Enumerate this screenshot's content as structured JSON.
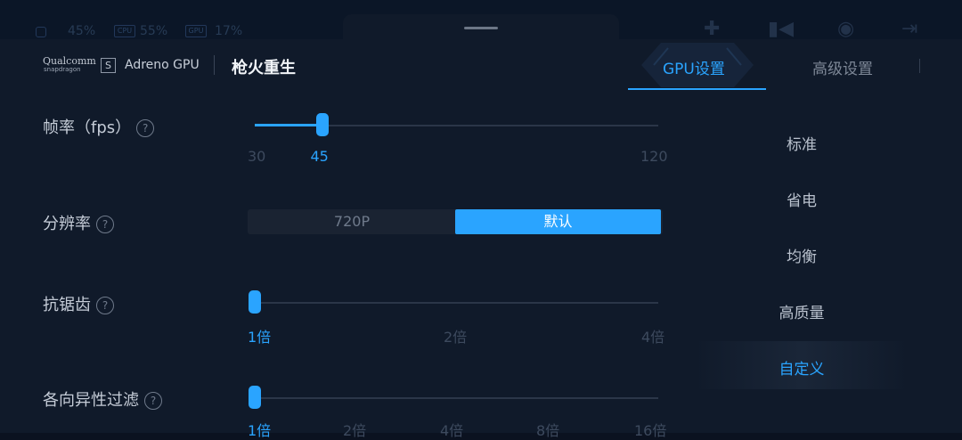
{
  "status_bar": {
    "battery": "45%",
    "cpu_label": "CPU",
    "cpu": "55%",
    "gpu_label": "GPU",
    "gpu": "17%",
    "icons": [
      "gamepad-icon",
      "video-icon",
      "disc-icon",
      "exit-icon"
    ]
  },
  "header": {
    "brand_main": "Qualcomm",
    "brand_sub": "snapdragon",
    "adreno_label": "Adreno GPU",
    "game_title": "枪火重生"
  },
  "tabs": [
    {
      "label": "GPU设置",
      "active": true
    },
    {
      "label": "高级设置",
      "active": false
    }
  ],
  "settings": {
    "fps": {
      "label": "帧率（fps）",
      "min": "30",
      "max": "120",
      "current": "45",
      "value": 45,
      "range": [
        30,
        120
      ]
    },
    "resolution": {
      "label": "分辨率",
      "options": [
        "720P",
        "默认"
      ],
      "selected": "默认"
    },
    "antialiasing": {
      "label": "抗锯齿",
      "ticks": [
        "1倍",
        "2倍",
        "4倍"
      ],
      "selected": "1倍"
    },
    "anisotropic": {
      "label": "各向异性过滤",
      "ticks": [
        "1倍",
        "2倍",
        "4倍",
        "8倍",
        "16倍"
      ],
      "selected": "1倍"
    }
  },
  "presets": [
    {
      "label": "标准",
      "active": false
    },
    {
      "label": "省电",
      "active": false
    },
    {
      "label": "均衡",
      "active": false
    },
    {
      "label": "高质量",
      "active": false
    },
    {
      "label": "自定义",
      "active": true
    }
  ],
  "colors": {
    "accent": "#2aa4ff",
    "background": "#101a2a"
  }
}
